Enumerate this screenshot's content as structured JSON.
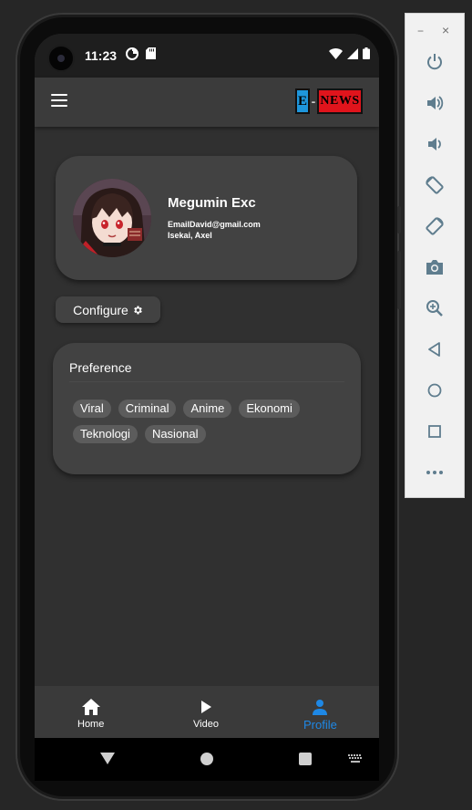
{
  "status_bar": {
    "time": "11:23"
  },
  "app_bar": {
    "logo_e": "E",
    "logo_dash": "-",
    "logo_news": "NEWS"
  },
  "profile": {
    "name": "Megumin Exc",
    "email": "EmailDavid@gmail.com",
    "extra": "Isekai, Axel"
  },
  "configure": {
    "label": "Configure"
  },
  "preference": {
    "title": "Preference",
    "chips": [
      "Viral",
      "Criminal",
      "Anime",
      "Ekonomi",
      "Teknologi",
      "Nasional"
    ]
  },
  "bottom_nav": {
    "items": [
      {
        "label": "Home",
        "icon": "home-icon",
        "active": false
      },
      {
        "label": "Video",
        "icon": "play-icon",
        "active": false
      },
      {
        "label": "Profile",
        "icon": "person-icon",
        "active": true
      }
    ]
  },
  "colors": {
    "accent": "#1e88e5",
    "card": "#424242",
    "background": "#303030",
    "logo_blue": "#1e96dc",
    "logo_red": "#e0141c"
  },
  "emulator_panel": {
    "icons": [
      "power-icon",
      "volume-up-icon",
      "volume-down-icon",
      "rotate-left-icon",
      "rotate-right-icon",
      "camera-icon",
      "zoom-icon",
      "back-icon",
      "home-icon",
      "overview-icon",
      "more-icon"
    ]
  }
}
